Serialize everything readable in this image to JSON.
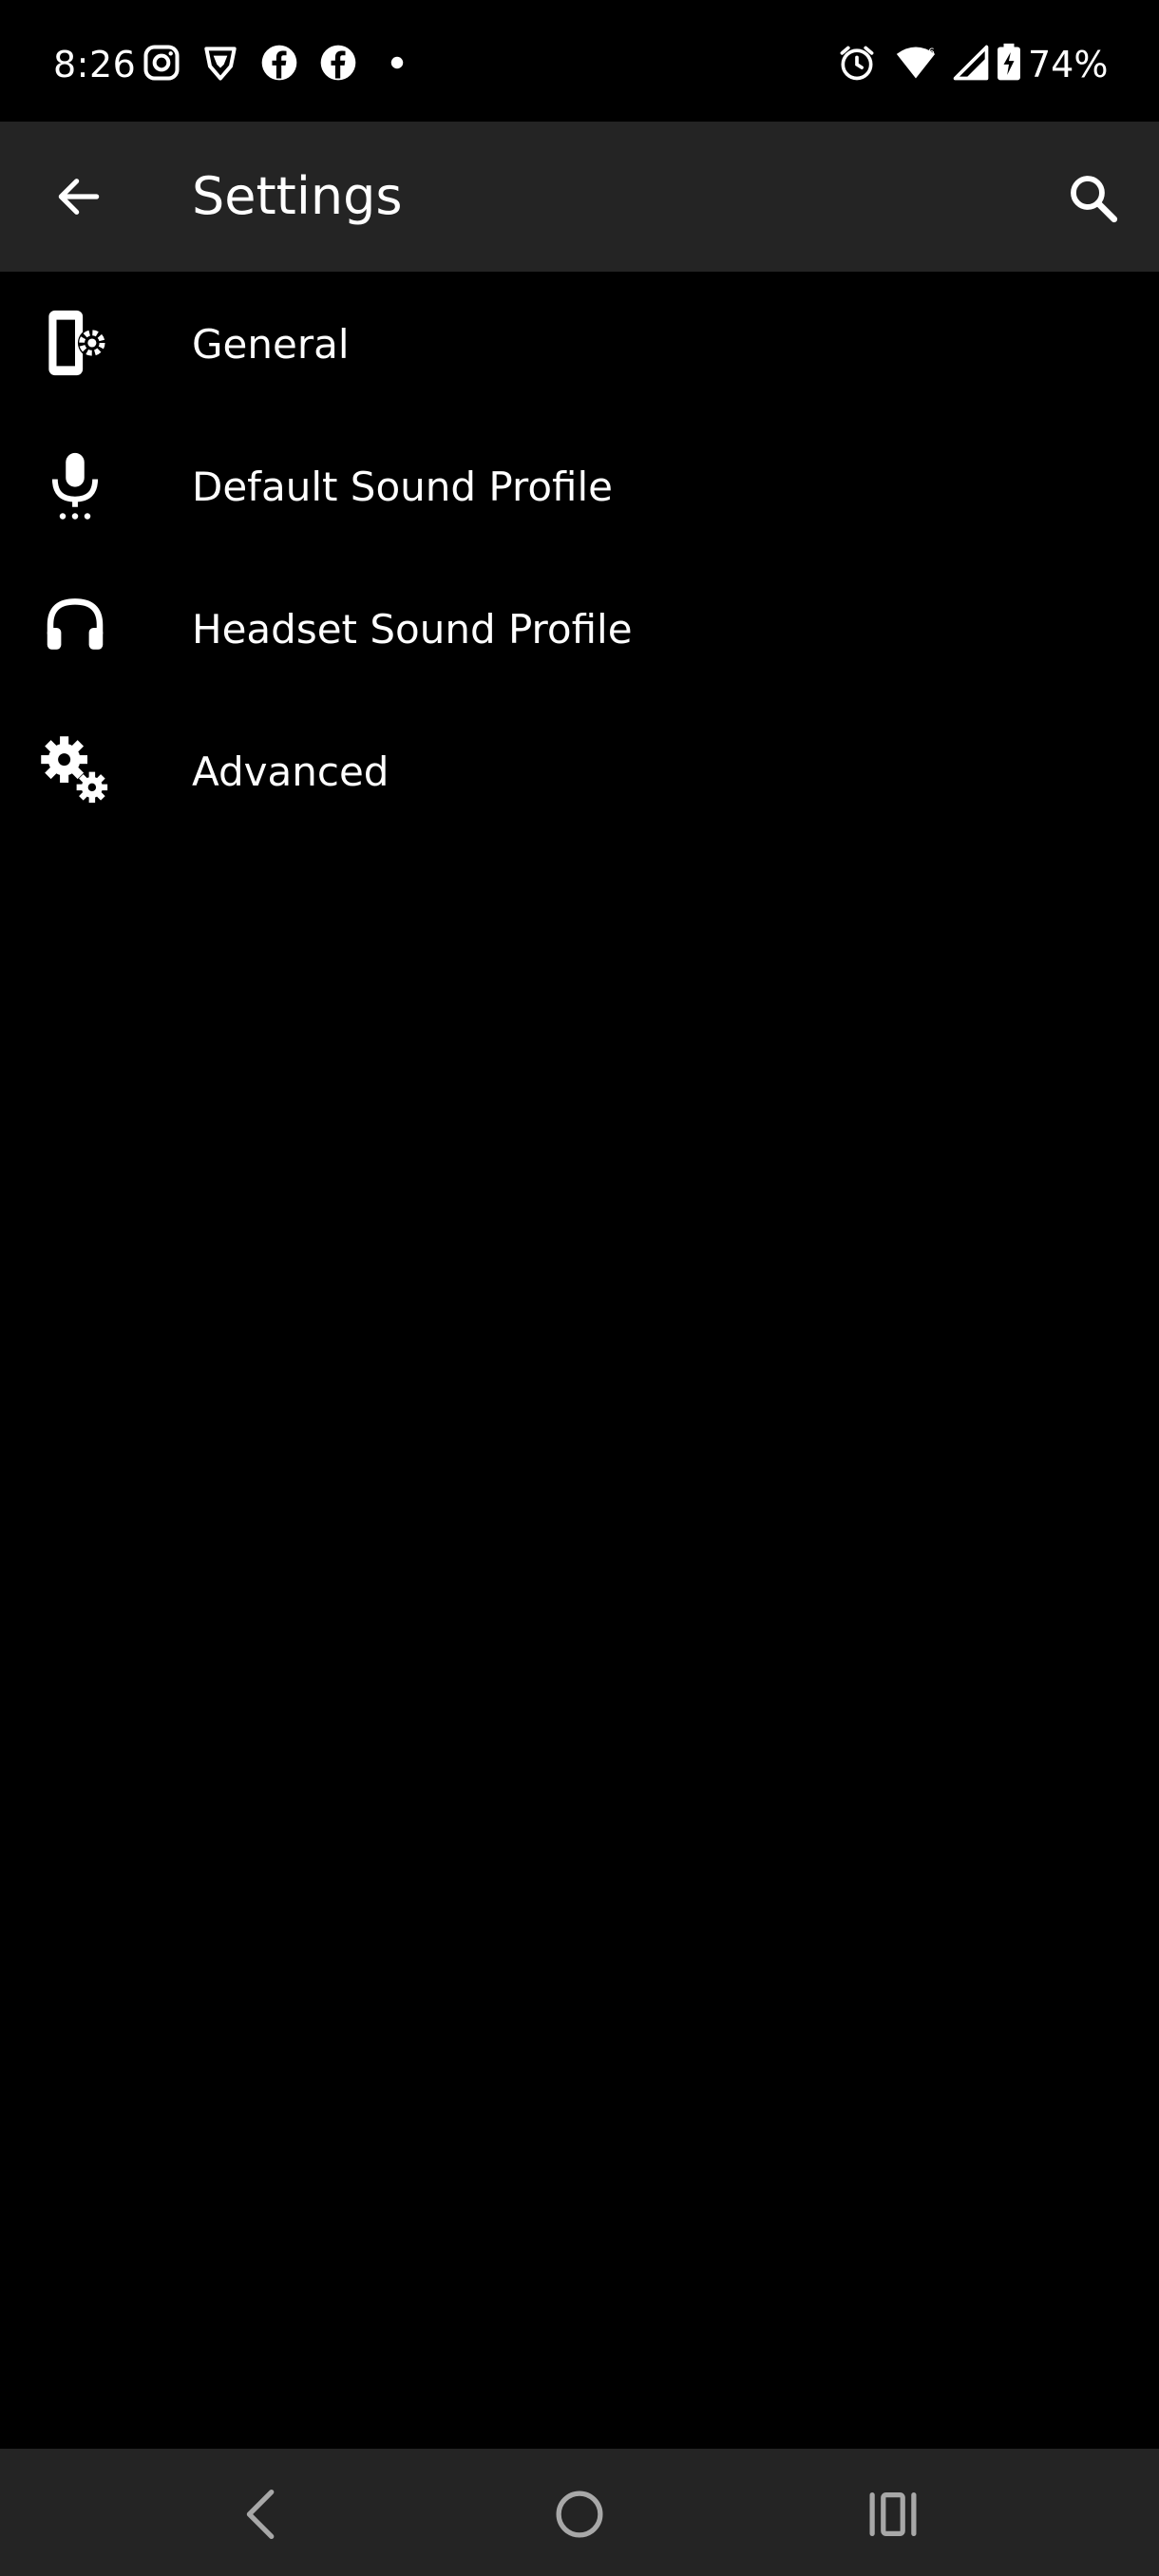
{
  "status_bar": {
    "time": "8:26",
    "battery_percent": "74%",
    "left_icons": [
      "instagram-icon",
      "brave-icon",
      "facebook-icon",
      "facebook-icon",
      "dot-icon"
    ],
    "right_icons": [
      "alarm-icon",
      "wifi-icon",
      "cell-signal-icon",
      "battery-charging-icon"
    ]
  },
  "app_bar": {
    "title": "Settings",
    "back_icon": "arrow-left-icon",
    "search_icon": "search-icon"
  },
  "menu": {
    "items": [
      {
        "label": "General",
        "icon": "phone-settings-icon"
      },
      {
        "label": "Default Sound Profile",
        "icon": "microphone-icon"
      },
      {
        "label": "Headset Sound Profile",
        "icon": "headset-icon"
      },
      {
        "label": "Advanced",
        "icon": "gears-icon"
      }
    ]
  },
  "nav_bar": {
    "buttons": [
      "nav-back-icon",
      "nav-home-icon",
      "nav-recents-icon"
    ]
  },
  "colors": {
    "background": "#000000",
    "bar": "#242424",
    "text": "#ffffff"
  }
}
